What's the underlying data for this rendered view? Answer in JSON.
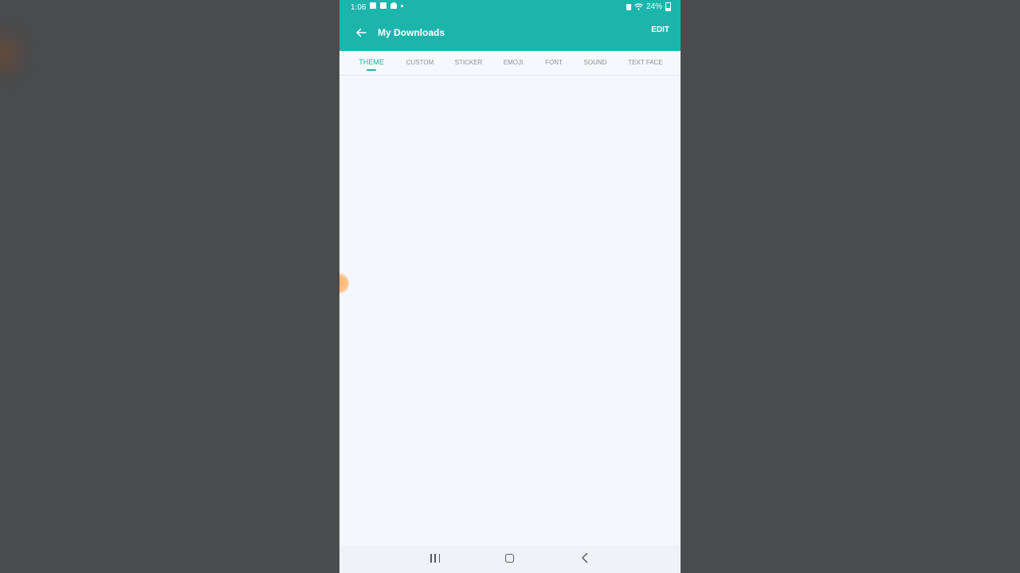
{
  "status_bar": {
    "time": "1:06",
    "battery_text": "24%",
    "icons": [
      "video-icon",
      "robot-icon",
      "cloud-icon",
      "dot-icon",
      "alarm-icon",
      "wifi-icon",
      "battery-icon"
    ]
  },
  "toolbar": {
    "title": "My Downloads",
    "edit_label": "EDIT",
    "back_icon": "arrow-left-icon"
  },
  "tabs": [
    {
      "label": "THEME",
      "active": true
    },
    {
      "label": "CUSTOM",
      "active": false
    },
    {
      "label": "STICKER",
      "active": false
    },
    {
      "label": "EMOJI",
      "active": false
    },
    {
      "label": "FONT",
      "active": false
    },
    {
      "label": "SOUND",
      "active": false
    },
    {
      "label": "TEXT FACE",
      "active": false
    }
  ],
  "nav_bar": {
    "icons": [
      "recents-icon",
      "home-icon",
      "back-icon"
    ]
  },
  "colors": {
    "accent": "#1cb5ac",
    "background": "#f4f7fb",
    "outer_background": "#4b4c4e"
  }
}
